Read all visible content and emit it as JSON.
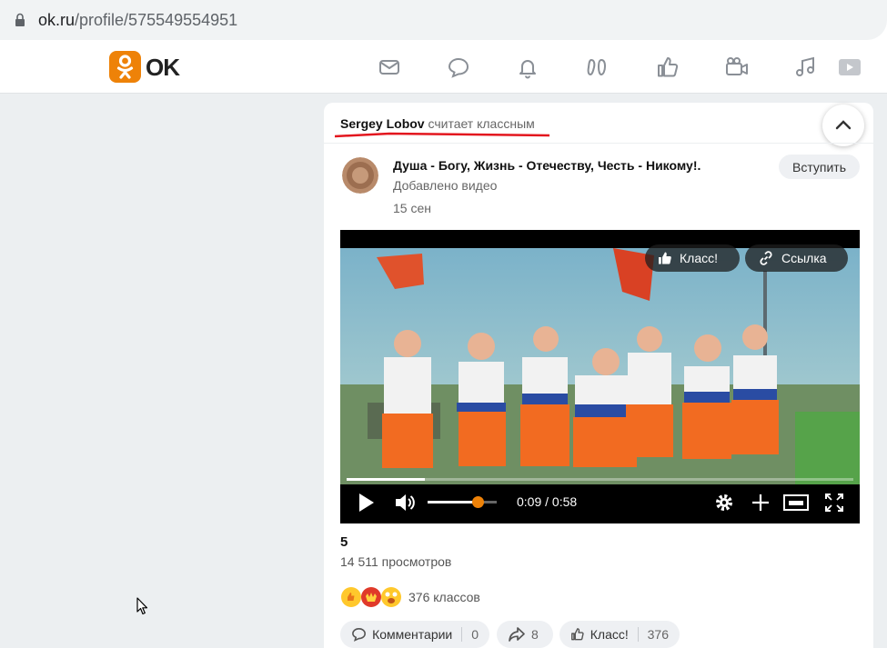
{
  "browser": {
    "url_host": "ok.ru",
    "url_path": "/profile/575549554951"
  },
  "nav": {
    "logo_text": "OK",
    "icons": [
      "mail-icon",
      "chat-icon",
      "bell-icon",
      "guests-icon",
      "like-icon",
      "video-camera-icon",
      "music-icon",
      "video-play-icon"
    ]
  },
  "post": {
    "actor_name": "Sergey Lobov",
    "actor_action": "считает классным",
    "group_name": "Душа - Богу, Жизнь - Отечеству, Честь - Никому!.",
    "added_text": "Добавлено видео",
    "date": "15 сен",
    "join_label": "Вступить",
    "video": {
      "klass_label": "Класс!",
      "link_label": "Ссылка",
      "time": "0:09 / 0:58",
      "progress": 0.155,
      "volume": 0.72
    },
    "title": "5",
    "views": "14 511 просмотров",
    "klass_summary": "376 классов",
    "actions": {
      "comments_label": "Комментарии",
      "comments_count": "0",
      "share_count": "8",
      "klass_label": "Класс!",
      "klass_count": "376"
    }
  },
  "colors": {
    "brand": "#ee8208",
    "underline": "#e3161e"
  }
}
